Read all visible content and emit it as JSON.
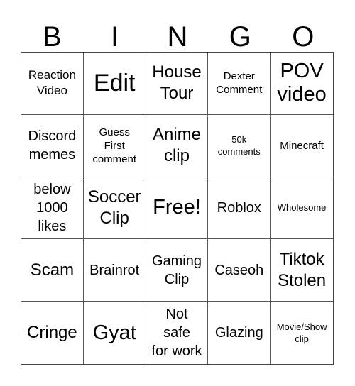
{
  "header": {
    "letters": [
      "B",
      "I",
      "N",
      "G",
      "O"
    ]
  },
  "cells": [
    {
      "text": "Reaction\nVideo",
      "size": "s-s"
    },
    {
      "text": "Edit",
      "size": "s-xl"
    },
    {
      "text": "House\nTour",
      "size": "s-ml"
    },
    {
      "text": "Dexter\nComment",
      "size": "s-xs"
    },
    {
      "text": "POV\nvideo",
      "size": "s-l"
    },
    {
      "text": "Discord\nmemes",
      "size": "s-m"
    },
    {
      "text": "Guess\nFirst\ncomment",
      "size": "s-xs"
    },
    {
      "text": "Anime\nclip",
      "size": "s-ml"
    },
    {
      "text": "50k\ncomments",
      "size": "s-xxs"
    },
    {
      "text": "Minecraft",
      "size": "s-xs"
    },
    {
      "text": "below\n1000\nlikes",
      "size": "s-m"
    },
    {
      "text": "Soccer\nClip",
      "size": "s-ml"
    },
    {
      "text": "Free!",
      "size": "s-l"
    },
    {
      "text": "Roblox",
      "size": "s-m"
    },
    {
      "text": "Wholesome",
      "size": "s-xxs"
    },
    {
      "text": "Scam",
      "size": "s-ml"
    },
    {
      "text": "Brainrot",
      "size": "s-m"
    },
    {
      "text": "Gaming\nClip",
      "size": "s-m"
    },
    {
      "text": "Caseoh",
      "size": "s-m"
    },
    {
      "text": "Tiktok\nStolen",
      "size": "s-ml"
    },
    {
      "text": "Cringe",
      "size": "s-ml"
    },
    {
      "text": "Gyat",
      "size": "s-l"
    },
    {
      "text": "Not\nsafe\nfor work",
      "size": "s-m"
    },
    {
      "text": "Glazing",
      "size": "s-m"
    },
    {
      "text": "Movie/Show\nclip",
      "size": "s-xxs"
    }
  ]
}
